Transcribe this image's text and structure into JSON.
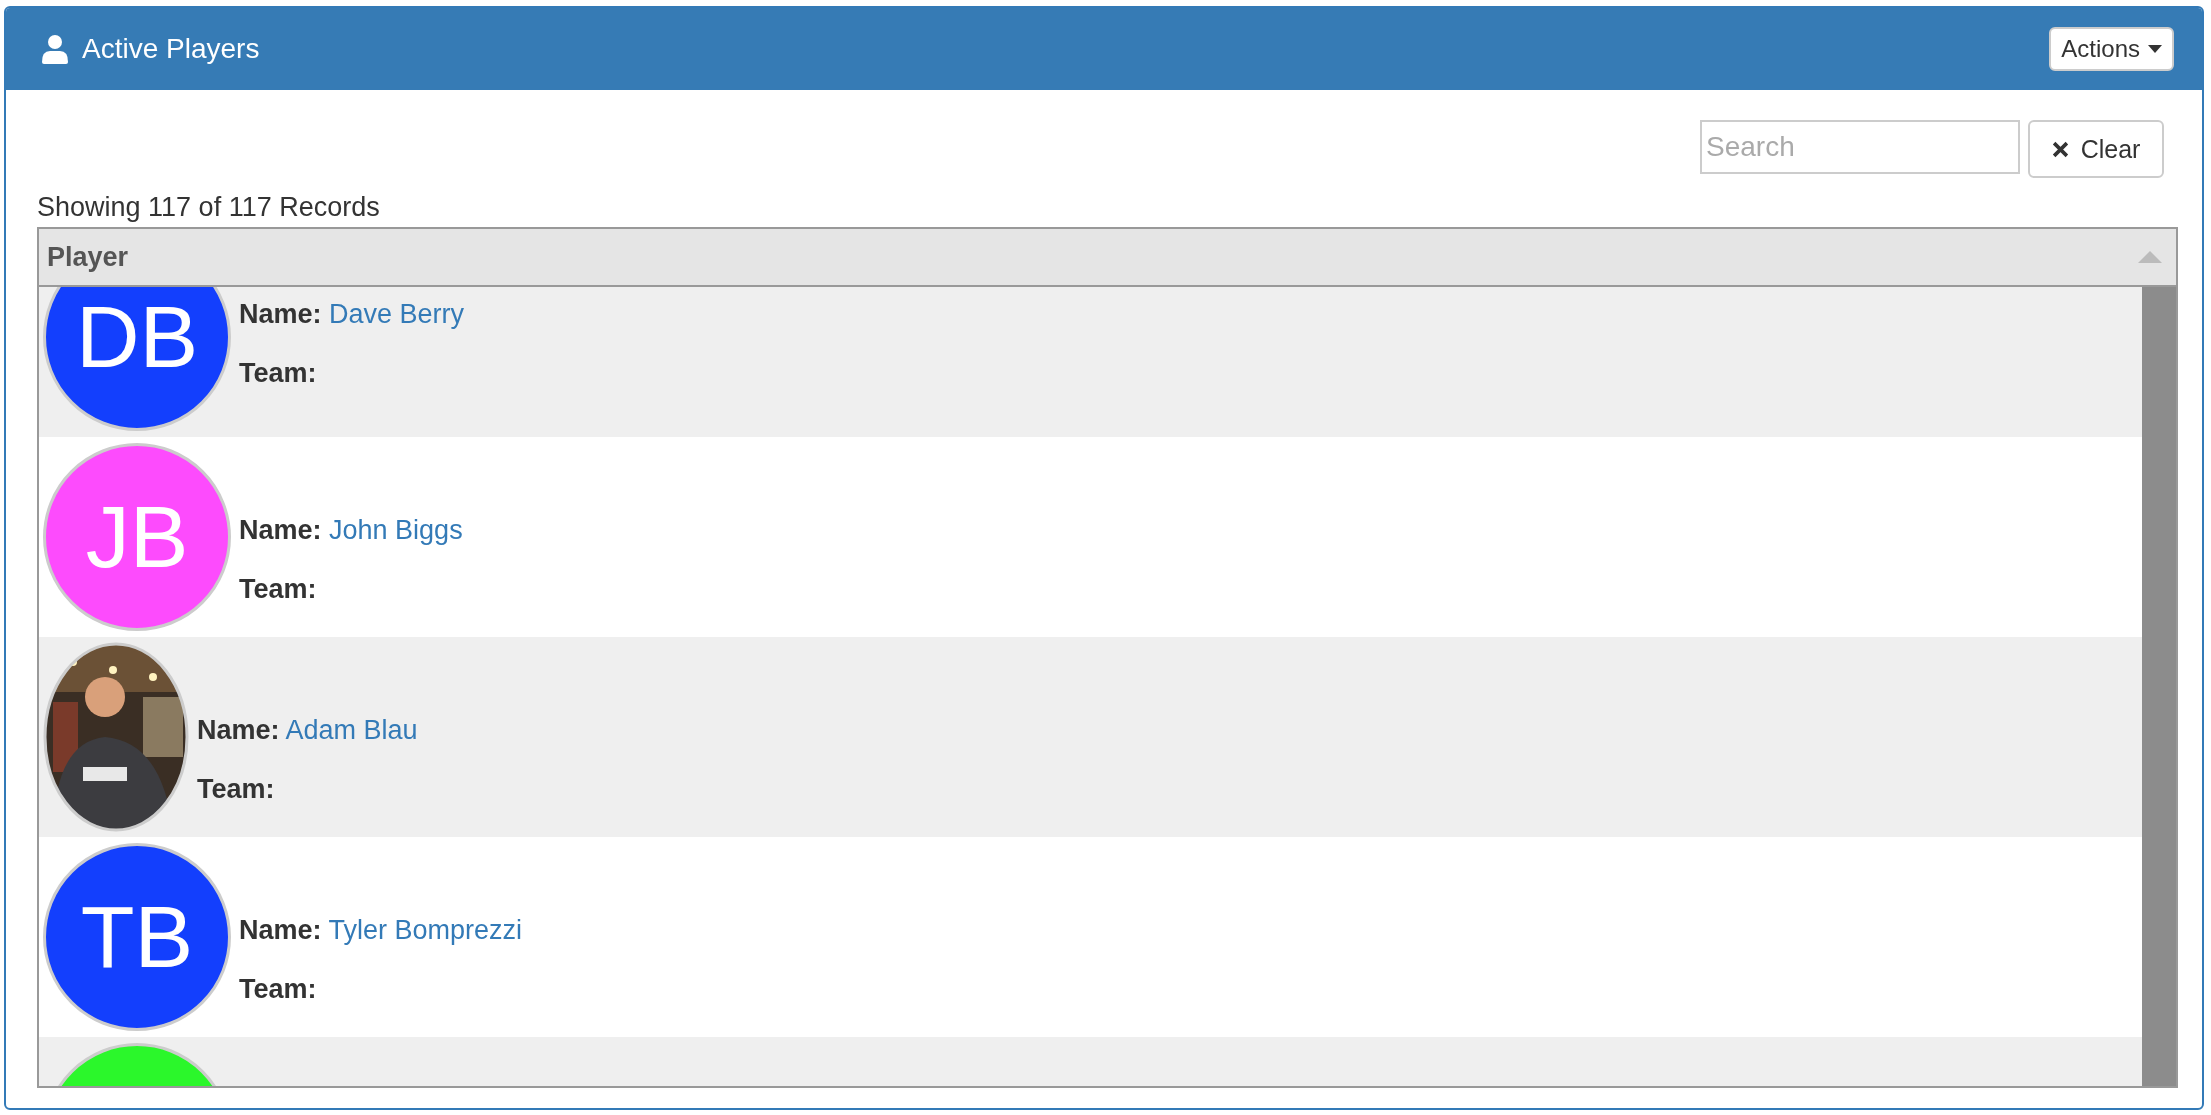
{
  "panel": {
    "title": "Active Players",
    "actions_button": "Actions"
  },
  "search": {
    "placeholder": "Search",
    "clear_button": "Clear"
  },
  "summary": "Showing 117 of 117 Records",
  "table": {
    "columns": [
      {
        "label": "Player",
        "sorted": true
      }
    ],
    "rows": [
      {
        "kind": "initials",
        "initials": "DB",
        "color": "#133ffd",
        "name_label": "Name:",
        "name": "Dave Berry",
        "team_label": "Team:"
      },
      {
        "kind": "initials",
        "initials": "JB",
        "color": "#fd4bfd",
        "name_label": "Name:",
        "name": "John Biggs",
        "team_label": "Team:"
      },
      {
        "kind": "picture",
        "name_label": "Name:",
        "name": "Adam Blau",
        "team_label": "Team:"
      },
      {
        "kind": "initials",
        "initials": "TB",
        "color": "#133ffd",
        "name_label": "Name:",
        "name": "Tyler Bomprezzi",
        "team_label": "Team:"
      },
      {
        "kind": "initials",
        "color": "#2bf72b"
      }
    ]
  }
}
